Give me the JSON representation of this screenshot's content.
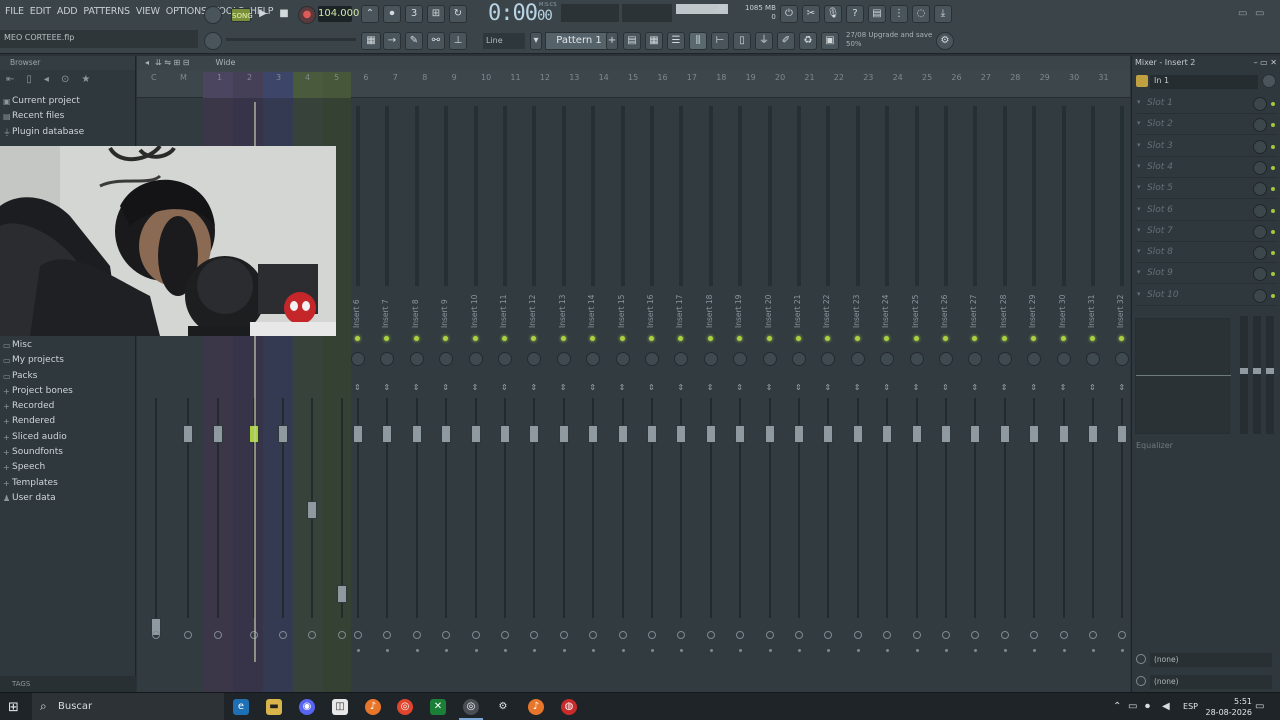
{
  "menus": [
    "FILE",
    "EDIT",
    "ADD",
    "PATTERNS",
    "VIEW",
    "OPTIONS",
    "TOOLS",
    "HELP"
  ],
  "project_file": "MEO CORTEEE.flp",
  "transport": {
    "mode_label": "SONG",
    "tempo": "104.000",
    "time": "0:00",
    "time_small": "00",
    "time_unit": "M:S:CS"
  },
  "cpu": {
    "voices": "38",
    "memory": "1085 MB",
    "cpu_count": "0"
  },
  "pattern": {
    "name": "Pattern 1",
    "snap": "Line"
  },
  "hint": {
    "line1": "27/08  Upgrade and save",
    "line2": "50%"
  },
  "browser": {
    "title": "Browser",
    "items_top": [
      "Current project",
      "Recent files",
      "Plugin database"
    ],
    "items_bottom": [
      "Misc",
      "My projects",
      "Packs",
      "Project bones",
      "Recorded",
      "Rendered",
      "Sliced audio",
      "Soundfonts",
      "Speech",
      "Templates",
      "User data"
    ],
    "tags_label": "TAGS"
  },
  "mixer": {
    "view_label": "Wide",
    "track_numbers": [
      "C",
      "M",
      "1",
      "2",
      "3",
      "4",
      "5",
      "6",
      "7",
      "8",
      "9",
      "10",
      "11",
      "12",
      "13",
      "14",
      "15",
      "16",
      "17",
      "18",
      "19",
      "20",
      "21",
      "22",
      "23",
      "24",
      "25",
      "26",
      "27",
      "28",
      "29",
      "30",
      "31"
    ],
    "insert_names": [
      "Insert 6",
      "Insert 7",
      "Insert 8",
      "Insert 9",
      "Insert 10",
      "Insert 11",
      "Insert 12",
      "Insert 13",
      "Insert 14",
      "Insert 15",
      "Insert 16",
      "Insert 17",
      "Insert 18",
      "Insert 19",
      "Insert 20",
      "Insert 21",
      "Insert 22",
      "Insert 23",
      "Insert 24",
      "Insert 25",
      "Insert 26",
      "Insert 27",
      "Insert 28",
      "Insert 29",
      "Insert 30",
      "Insert 31",
      "Insert 32"
    ]
  },
  "insert_panel": {
    "title": "Mixer - Insert 2",
    "input": "In 1",
    "slots": [
      "Slot 1",
      "Slot 2",
      "Slot 3",
      "Slot 4",
      "Slot 5",
      "Slot 6",
      "Slot 7",
      "Slot 8",
      "Slot 9",
      "Slot 10"
    ],
    "eq_label": "Equalizer",
    "out1": "(none)",
    "out2": "(none)"
  },
  "taskbar": {
    "search_placeholder": "Buscar",
    "lang": "ESP",
    "time": "5:51",
    "date": "28-08-2026"
  },
  "colors": {
    "accent_green": "#a9d142",
    "strip_purple": "#4b4560",
    "strip_blue": "#3d4668",
    "strip_green": "#46573a"
  }
}
